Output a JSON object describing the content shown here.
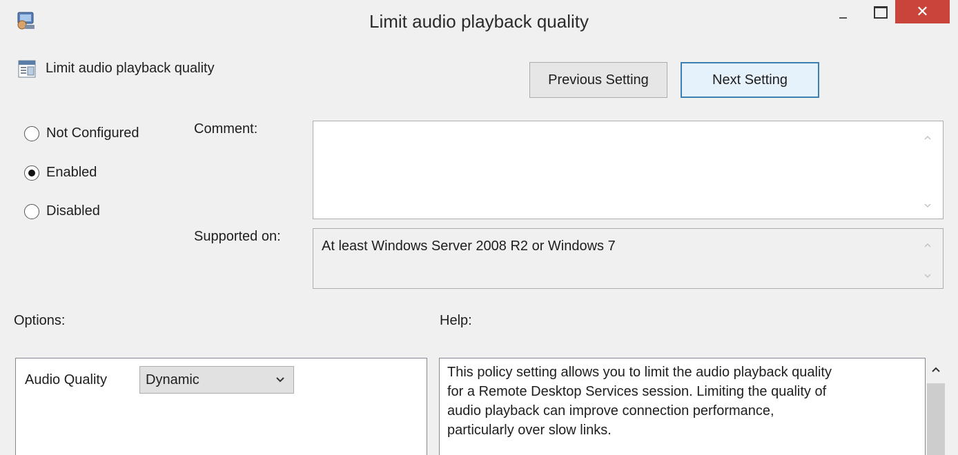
{
  "window": {
    "title": "Limit audio playback quality",
    "close_glyph": "✕"
  },
  "header": {
    "setting_name": "Limit audio playback quality",
    "prev_label": "Previous Setting",
    "next_label": "Next Setting"
  },
  "state": {
    "options": [
      {
        "label": "Not Configured",
        "checked": false
      },
      {
        "label": "Enabled",
        "checked": true
      },
      {
        "label": "Disabled",
        "checked": false
      }
    ]
  },
  "comment": {
    "label": "Comment:",
    "value": ""
  },
  "supported": {
    "label": "Supported on:",
    "value": "At least Windows Server 2008 R2 or Windows 7"
  },
  "options_section": {
    "label": "Options:",
    "audio_quality_label": "Audio Quality",
    "audio_quality_value": "Dynamic"
  },
  "help_section": {
    "label": "Help:",
    "lines": [
      "This policy setting allows you to limit the audio playback quality",
      "for a Remote Desktop Services session. Limiting the quality of",
      "audio playback can improve connection performance,",
      "particularly over slow links."
    ]
  },
  "icons": {
    "app": "group-policy-editor-icon",
    "setting": "policy-setting-icon"
  },
  "colors": {
    "close_button": "#c9453b",
    "next_button_border": "#3c7fb1",
    "background": "#f0f0f0"
  }
}
